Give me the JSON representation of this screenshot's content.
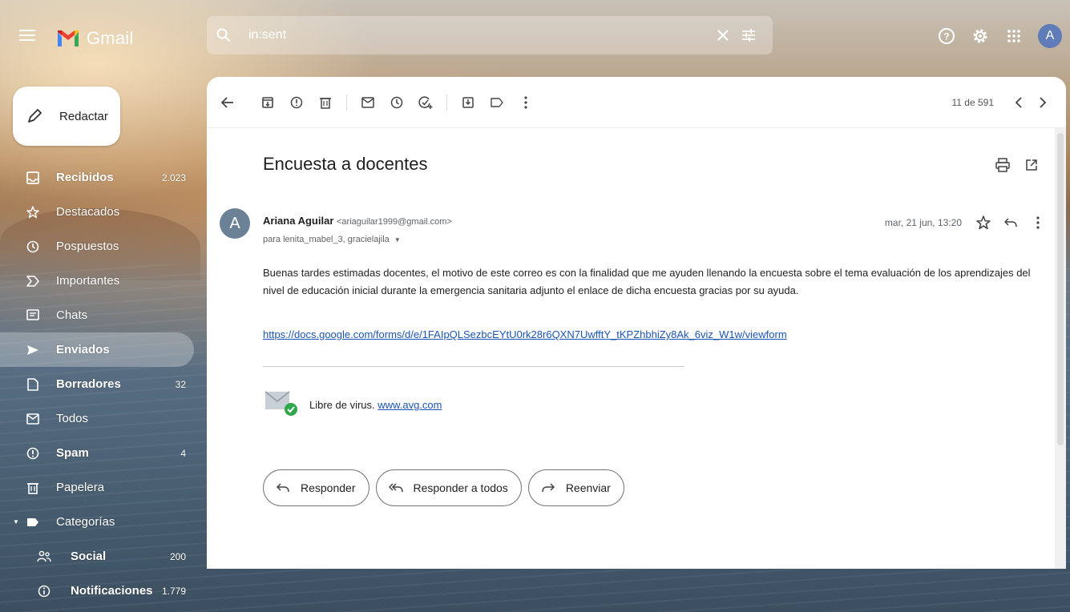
{
  "app": {
    "name": "Gmail"
  },
  "search": {
    "query": "in:sent"
  },
  "compose": {
    "label": "Redactar"
  },
  "sidebar": {
    "items": [
      {
        "label": "Recibidos",
        "count": "2.023",
        "icon": "inbox-icon"
      },
      {
        "label": "Destacados",
        "count": "",
        "icon": "star-icon"
      },
      {
        "label": "Pospuestos",
        "count": "",
        "icon": "clock-icon"
      },
      {
        "label": "Importantes",
        "count": "",
        "icon": "important-icon"
      },
      {
        "label": "Chats",
        "count": "",
        "icon": "chat-icon"
      },
      {
        "label": "Enviados",
        "count": "",
        "icon": "send-icon"
      },
      {
        "label": "Borradores",
        "count": "32",
        "icon": "draft-icon"
      },
      {
        "label": "Todos",
        "count": "",
        "icon": "mail-icon"
      },
      {
        "label": "Spam",
        "count": "4",
        "icon": "spam-icon"
      },
      {
        "label": "Papelera",
        "count": "",
        "icon": "trash-icon"
      },
      {
        "label": "Categorías",
        "count": "",
        "icon": "label-icon"
      },
      {
        "label": "Social",
        "count": "200",
        "icon": "people-icon"
      },
      {
        "label": "Notificaciones",
        "count": "1.779",
        "icon": "info-icon"
      }
    ]
  },
  "pager": {
    "text": "11 de 591"
  },
  "message": {
    "subject": "Encuesta a docentes",
    "sender_initial": "A",
    "sender_name": "Ariana Aguilar",
    "sender_email": "<ariaguilar1999@gmail.com>",
    "recipients": "para lenita_mabel_3, gracielajila",
    "date": "mar, 21 jun, 13:20",
    "body": "Buenas tardes estimadas docentes, el motivo de este correo es con la finalidad que me ayuden llenando la encuesta sobre el tema evaluación de los aprendizajes del nivel de educación inicial  durante la emergencia sanitaria adjunto el enlace de dicha encuesta gracias por su ayuda.",
    "link": "https://docs.google.com/forms/d/e/1FAIpQLSezbcEYtU0rk28r6QXN7UwfftY_tKPZhbhiZy8Ak_6viz_W1w/viewform",
    "virus_text": "Libre de virus.",
    "virus_link": "www.avg.com"
  },
  "actions": {
    "reply": "Responder",
    "reply_all": "Responder a todos",
    "forward": "Reenviar"
  },
  "user": {
    "initial": "A"
  },
  "colors": {
    "link": "#1a55b5",
    "avatar_top": "#5f7cb8",
    "sender_avatar": "#6b8196"
  }
}
